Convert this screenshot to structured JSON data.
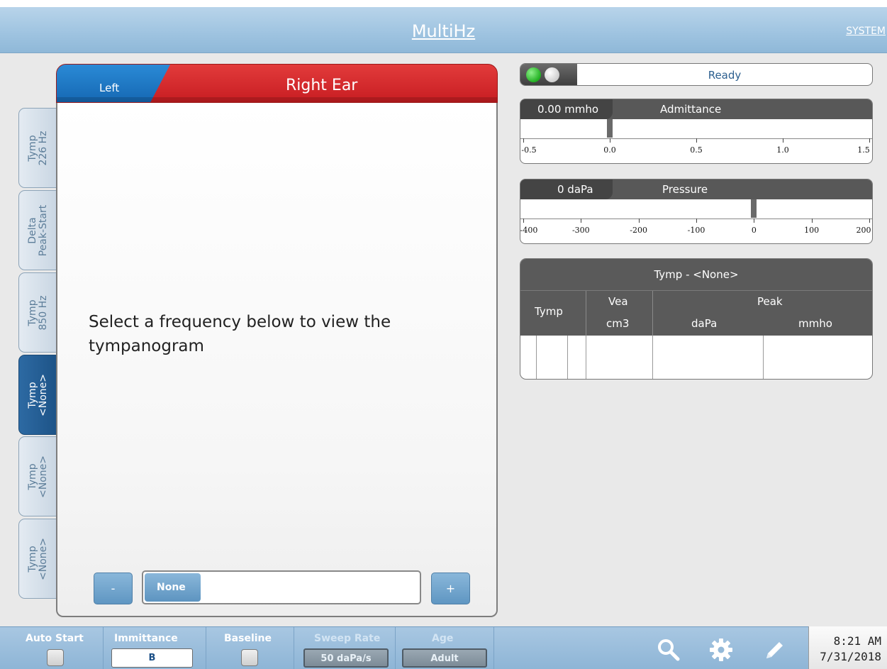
{
  "header": {
    "title": "MultiHz",
    "system_link": "SYSTEM"
  },
  "ear": {
    "left_label": "Left",
    "right_label": "Right Ear",
    "left_color": "#1a74c4",
    "right_color": "#d32a2e"
  },
  "tabs": [
    {
      "line1": "Tymp",
      "line2": "226 Hz",
      "active": false
    },
    {
      "line1": "Delta",
      "line2": "Peak-Start",
      "active": false
    },
    {
      "line1": "Tymp",
      "line2": "850 Hz",
      "active": false
    },
    {
      "line1": "Tymp",
      "line2": "<None>",
      "active": true
    },
    {
      "line1": "Tymp",
      "line2": "<None>",
      "active": false
    },
    {
      "line1": "Tymp",
      "line2": "<None>",
      "active": false
    }
  ],
  "main": {
    "message": "Select a frequency below to view the tympanogram"
  },
  "stepper": {
    "minus": "-",
    "plus": "+",
    "value": "None"
  },
  "status": {
    "text": "Ready",
    "lights": [
      "green",
      "grey"
    ]
  },
  "admittance": {
    "readout": "0.00 mmho",
    "label": "Admittance",
    "ticks": [
      "-0.5",
      "0.0",
      "0.5",
      "1.0",
      "1.5"
    ],
    "value": 0.0
  },
  "pressure": {
    "readout": "0 daPa",
    "label": "Pressure",
    "ticks": [
      "-400",
      "-300",
      "-200",
      "-100",
      "0",
      "100",
      "200"
    ],
    "value": 0
  },
  "results": {
    "title": "Tymp - <None>",
    "col_tymp": "Tymp",
    "col_vea": "Vea",
    "col_vea_unit": "cm3",
    "col_peak": "Peak",
    "col_peak_dapa": "daPa",
    "col_peak_mmho": "mmho"
  },
  "toolbar": {
    "auto_start": "Auto Start",
    "immittance": "Immittance",
    "immittance_value": "B",
    "baseline": "Baseline",
    "sweep_rate": "Sweep Rate",
    "sweep_rate_value": "50 daPa/s",
    "age": "Age",
    "age_value": "Adult",
    "icons": [
      "search-icon",
      "gear-icon",
      "pencil-icon"
    ]
  },
  "clock": {
    "time": "8:21 AM",
    "date": "7/31/2018"
  }
}
